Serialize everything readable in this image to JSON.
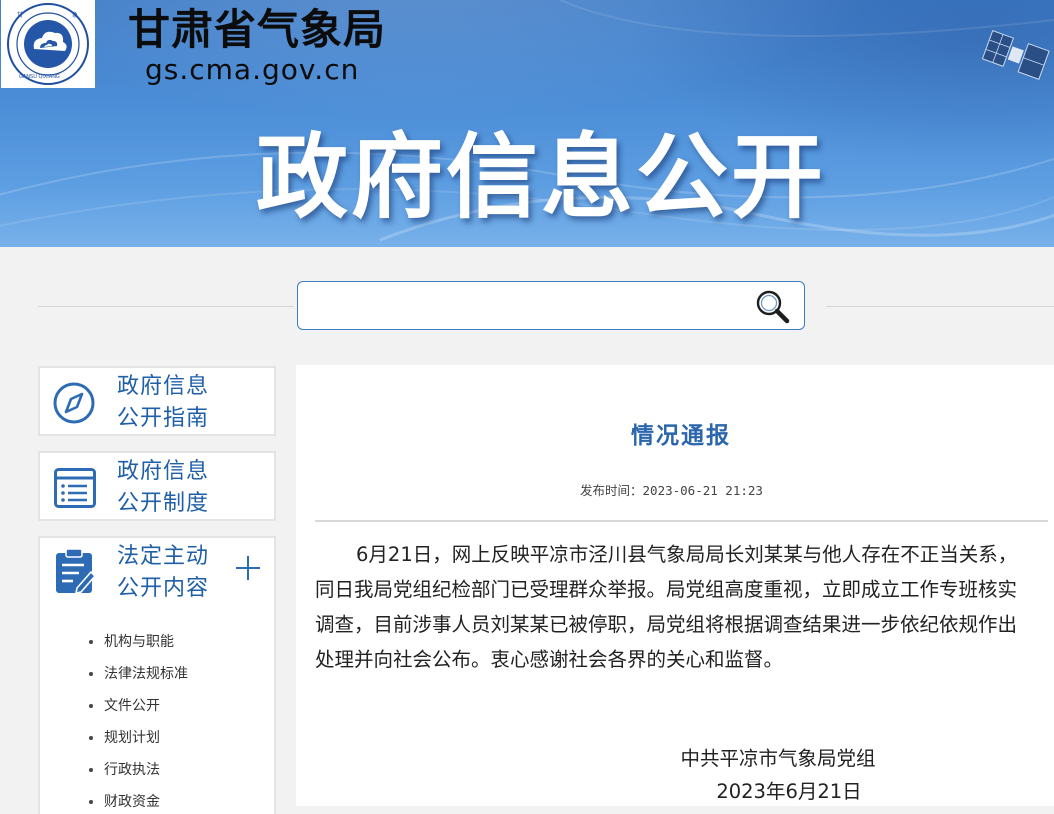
{
  "header": {
    "site_name": "甘肃省气象局",
    "domain": "gs.cma.gov.cn",
    "logo_text": "GANSU QIXIANG 甘肃气象",
    "banner_title": "政府信息公开",
    "colors": {
      "banner": "#4d8fd8",
      "accent": "#1f5fa8",
      "title": "#2b66ad"
    }
  },
  "search": {
    "placeholder": "",
    "value": "",
    "button_icon": "magnifier-icon"
  },
  "sidebar": {
    "cards": [
      {
        "line1": "政府信息",
        "line2": "公开指南",
        "icon": "compass-icon"
      },
      {
        "line1": "政府信息",
        "line2": "公开制度",
        "icon": "list-icon"
      },
      {
        "line1": "法定主动",
        "line2": "公开内容",
        "icon": "clipboard-edit-icon",
        "expand_icon": "plus-icon"
      }
    ],
    "subitems": [
      "机构与职能",
      "法律法规标准",
      "文件公开",
      "规划计划",
      "行政执法",
      "财政资金"
    ]
  },
  "article": {
    "title": "情况通报",
    "publish_label": "发布时间：",
    "publish_time": "2023-06-21 21:23",
    "body": "6月21日，网上反映平凉市泾川县气象局局长刘某某与他人存在不正当关系，同日我局党组纪检部门已受理群众举报。局党组高度重视，立即成立工作专班核实调查，目前涉事人员刘某某已被停职，局党组将根据调查结果进一步依纪依规作出处理并向社会公布。衷心感谢社会各界的关心和监督。",
    "signature": "中共平凉市气象局党组",
    "date": "2023年6月21日"
  }
}
